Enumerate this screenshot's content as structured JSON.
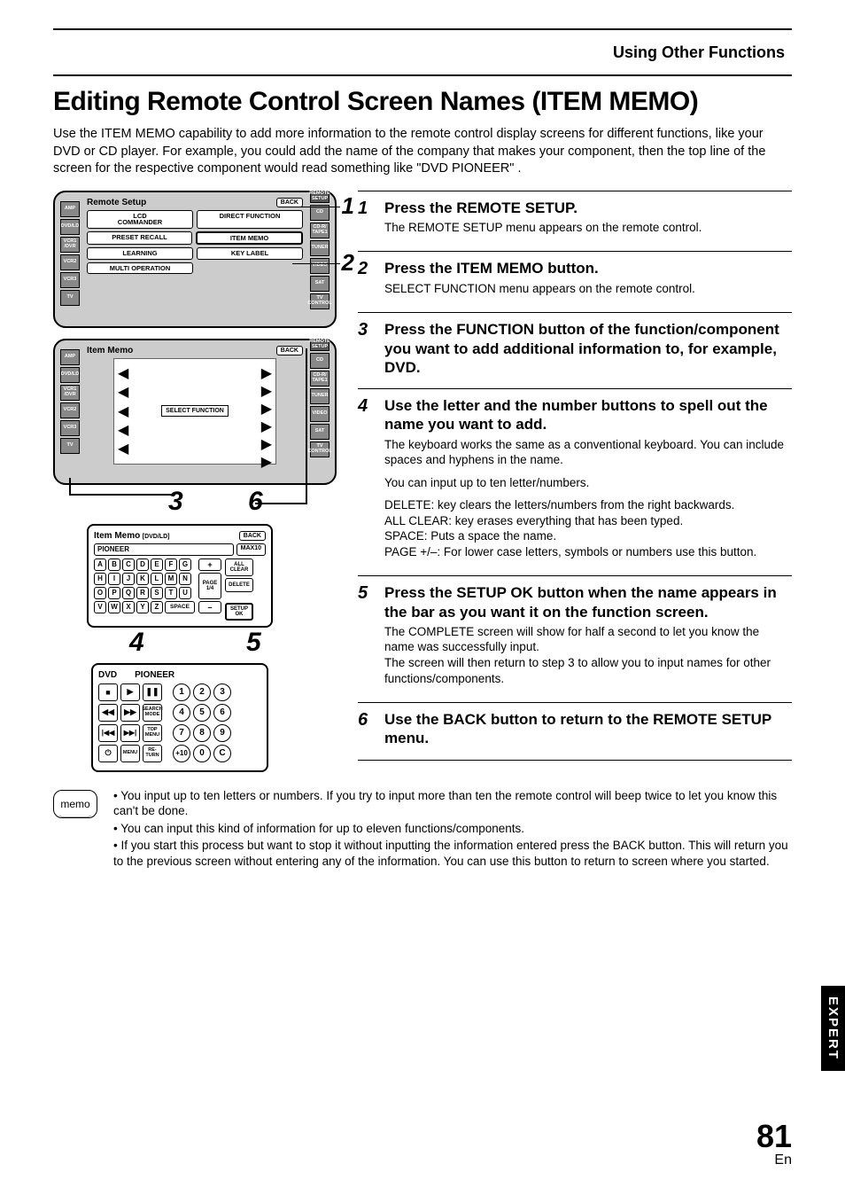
{
  "header": {
    "section": "Using Other Functions"
  },
  "title": "Editing Remote Control Screen Names (ITEM MEMO)",
  "intro": "Use the ITEM MEMO capability to add more information to the remote control display screens for different functions, like your DVD or CD player. For example, you could add the name of the company that makes your component, then the top line of the screen for the respective component would read something like \"DVD PIONEER\" .",
  "diagram1": {
    "title": "Remote Setup",
    "back": "BACK",
    "right_top": "REMOTE\nSETUP",
    "left_labels": [
      "AMP",
      "DVD/LD",
      "VCR1\n/DVR",
      "VCR2",
      "VCR3",
      "TV"
    ],
    "right_labels": [
      "CD",
      "CD-R/\nTAPE1",
      "TUNER",
      "VIDEO",
      "SAT",
      "TV\nCONTROL"
    ],
    "buttons": {
      "lcd": "LCD\nCOMMANDER",
      "direct": "DIRECT FUNCTION",
      "preset": "PRESET RECALL",
      "item_memo": "ITEM MEMO",
      "learning": "LEARNING",
      "key_label": "KEY LABEL",
      "multi": "MULTI OPERATION"
    },
    "callout1": "1",
    "callout2": "2"
  },
  "diagram2": {
    "title": "Item Memo",
    "back": "BACK",
    "select": "SELECT FUNCTION",
    "callout3": "3",
    "callout6": "6"
  },
  "keyboard": {
    "title": "Item Memo",
    "sub": "[DVD/LD]",
    "back": "BACK",
    "field_value": "PIONEER",
    "max": "MAX10",
    "rows": [
      [
        "A",
        "B",
        "C",
        "D",
        "E",
        "F",
        "G"
      ],
      [
        "H",
        "I",
        "J",
        "K",
        "L",
        "M",
        "N"
      ],
      [
        "O",
        "P",
        "Q",
        "R",
        "S",
        "T",
        "U"
      ],
      [
        "V",
        "W",
        "X",
        "Y",
        "Z"
      ]
    ],
    "space": "SPACE",
    "plus": "+",
    "minus": "–",
    "page": "PAGE\n1/4",
    "allclear": "ALL\nCLEAR",
    "delete": "DELETE",
    "setupok": "SETUP\nOK",
    "callout4": "4",
    "callout5": "5"
  },
  "dv": {
    "left_title": "DVD",
    "right_title": "PIONEER",
    "row1": [
      "■",
      "▶",
      "❚❚"
    ],
    "nums1": [
      "1",
      "2",
      "3"
    ],
    "row2": [
      "◀◀",
      "▶▶"
    ],
    "search": "SEARCH\nMODE",
    "nums2": [
      "4",
      "5",
      "6"
    ],
    "row3": [
      "|◀◀",
      "▶▶|"
    ],
    "topmenu": "TOP\nMENU",
    "nums3": [
      "7",
      "8",
      "9"
    ],
    "power": "⏻",
    "menu": "MENU",
    "return": "RE-\nTURN",
    "nums4": [
      "+10",
      "0",
      "C"
    ]
  },
  "steps": [
    {
      "num": "1",
      "title": "Press the REMOTE SETUP.",
      "paras": [
        "The REMOTE SETUP menu appears on the remote control."
      ]
    },
    {
      "num": "2",
      "title": "Press the ITEM MEMO button.",
      "paras": [
        "SELECT FUNCTION menu appears on the remote control."
      ]
    },
    {
      "num": "3",
      "title": "Press the FUNCTION button of the function/component you want to add additional information to, for example, DVD.",
      "paras": []
    },
    {
      "num": "4",
      "title": "Use the letter and the number buttons to spell out the name you want to add.",
      "paras": [
        "The keyboard works the same as a conventional keyboard. You can include spaces and hyphens in the name.",
        "You can input up to ten letter/numbers.",
        "DELETE: key clears the letters/numbers from the right backwards.\nALL CLEAR: key erases everything that has been typed.\nSPACE: Puts a space the name.\nPAGE +/–:  For lower case letters, symbols  or numbers use this button."
      ]
    },
    {
      "num": "5",
      "title": "Press the SETUP OK button when the name appears in the bar as you want it on the function screen.",
      "paras": [
        "The COMPLETE screen will show for half a second to let you know the name was successfully input.\nThe screen will then return to step 3 to allow you to input names for other functions/components."
      ]
    },
    {
      "num": "6",
      "title": "Use the BACK button to return to the REMOTE SETUP menu.",
      "paras": []
    }
  ],
  "memo": {
    "label": "memo",
    "items": [
      "You input up to ten letters or numbers. If you try to input more than ten the remote control will beep twice to let you know this can't be done.",
      "You can input this kind of information for up to eleven functions/components.",
      "If you start this process but want to stop it without inputting the information entered press the BACK button. This will return you to the previous screen without entering any of the information. You can use this button to return to screen where you started."
    ]
  },
  "tab": "EXPERT",
  "page": {
    "num": "81",
    "lang": "En"
  }
}
